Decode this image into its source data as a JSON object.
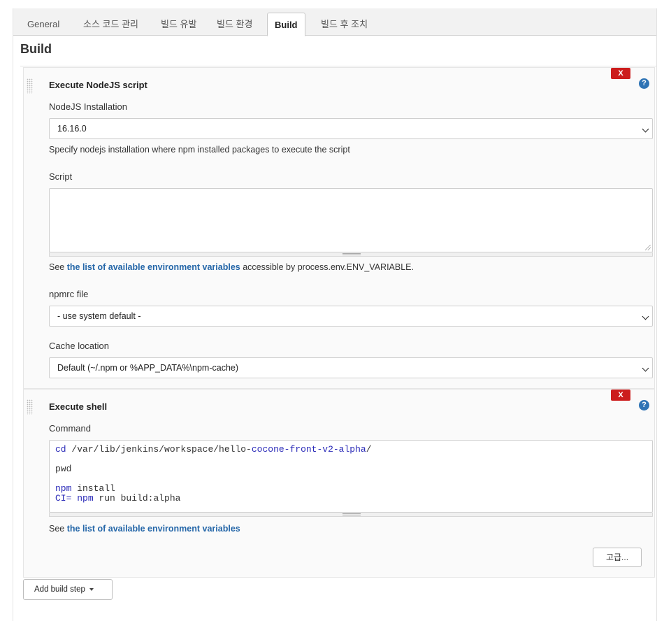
{
  "tabs": [
    {
      "label": "General"
    },
    {
      "label": "소스 코드 관리"
    },
    {
      "label": "빌드 유발"
    },
    {
      "label": "빌드 환경"
    },
    {
      "label": "Build"
    },
    {
      "label": "빌드 후 조치"
    }
  ],
  "section_title": "Build",
  "nodejs_step": {
    "title": "Execute NodeJS script",
    "delete_label": "X",
    "help_label": "?",
    "installation_label": "NodeJS Installation",
    "installation_value": "16.16.0",
    "installation_desc": "Specify nodejs installation where npm installed packages to execute the script",
    "script_label": "Script",
    "script_value": "",
    "env_desc_prefix": "See ",
    "env_link": "the list of available environment variables",
    "env_desc_suffix": " accessible by process.env.ENV_VARIABLE.",
    "npmrc_label": "npmrc file",
    "npmrc_value": "- use system default -",
    "cache_label": "Cache location",
    "cache_value": "Default (~/.npm or %APP_DATA%\\npm-cache)"
  },
  "shell_step": {
    "title": "Execute shell",
    "delete_label": "X",
    "help_label": "?",
    "command_label": "Command",
    "command_lines": [
      [
        {
          "t": "cd",
          "k": true
        },
        {
          "t": " /var/lib/jenkins/workspace/hello-",
          "k": false
        },
        {
          "t": "cocone-front-v2-alpha",
          "k": true
        },
        {
          "t": "/",
          "k": false
        }
      ],
      [],
      [
        {
          "t": "pwd",
          "k": false
        }
      ],
      [],
      [
        {
          "t": "npm",
          "k": true
        },
        {
          "t": " install",
          "k": false
        }
      ],
      [
        {
          "t": "CI=",
          "k": true
        },
        {
          "t": " ",
          "k": false
        },
        {
          "t": "npm",
          "k": true
        },
        {
          "t": " run build:alpha",
          "k": false
        }
      ]
    ],
    "env_desc_prefix": "See ",
    "env_link": "the list of available environment variables",
    "advanced_label": "고급..."
  },
  "add_build_step_label": "Add build step",
  "colors": {
    "accent": "#2466a8",
    "danger": "#cc1c1c",
    "help": "#2f74b5"
  }
}
